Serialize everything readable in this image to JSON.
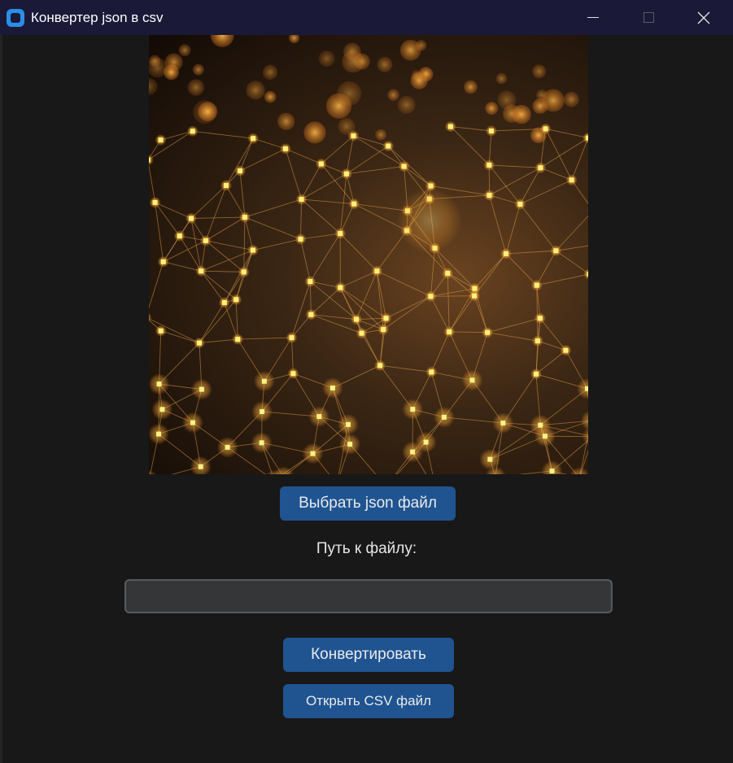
{
  "window": {
    "title": "Конвертер json в csv"
  },
  "image": {
    "description_icon": "network-image-icon"
  },
  "controls": {
    "choose_button": "Выбрать json файл",
    "path_label": "Путь к файлу:",
    "path_value": "",
    "convert_button": "Конвертировать",
    "open_button": "Открыть CSV файл"
  },
  "colors": {
    "titlebar": "#1a1a38",
    "background": "#181818",
    "button": "#1f5491",
    "accent_icon": "#2b8ee8"
  }
}
